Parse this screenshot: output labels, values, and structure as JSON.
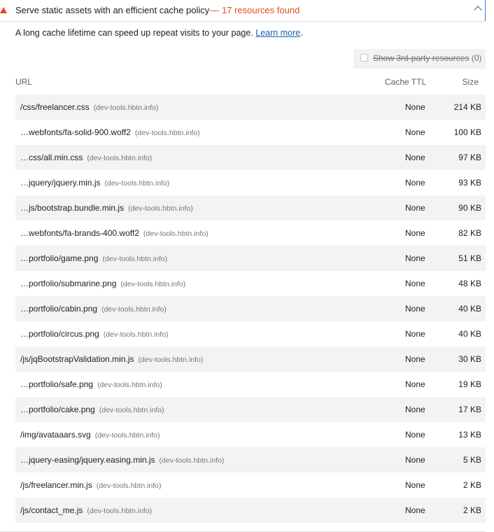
{
  "audit": {
    "title": "Serve static assets with an efficient cache policy",
    "dash": "—",
    "count_text": "17 resources found",
    "description": "A long cache lifetime can speed up repeat visits to your page.",
    "learn_more": "Learn more",
    "trailing_period": ".",
    "icon": "warning-triangle",
    "warning_color": "#e8491d"
  },
  "filter": {
    "label": "Show 3rd-party resources",
    "count": "(0)",
    "checked": false
  },
  "table": {
    "headers": {
      "url": "URL",
      "ttl": "Cache TTL",
      "size": "Size"
    },
    "rows": [
      {
        "url": "/css/freelancer.css",
        "host": "(dev-tools.hbtn.info)",
        "ttl": "None",
        "size": "214 KB"
      },
      {
        "url": "…webfonts/fa-solid-900.woff2",
        "host": "(dev-tools.hbtn.info)",
        "ttl": "None",
        "size": "100 KB"
      },
      {
        "url": "…css/all.min.css",
        "host": "(dev-tools.hbtn.info)",
        "ttl": "None",
        "size": "97 KB"
      },
      {
        "url": "…jquery/jquery.min.js",
        "host": "(dev-tools.hbtn.info)",
        "ttl": "None",
        "size": "93 KB"
      },
      {
        "url": "…js/bootstrap.bundle.min.js",
        "host": "(dev-tools.hbtn.info)",
        "ttl": "None",
        "size": "90 KB"
      },
      {
        "url": "…webfonts/fa-brands-400.woff2",
        "host": "(dev-tools.hbtn.info)",
        "ttl": "None",
        "size": "82 KB"
      },
      {
        "url": "…portfolio/game.png",
        "host": "(dev-tools.hbtn.info)",
        "ttl": "None",
        "size": "51 KB"
      },
      {
        "url": "…portfolio/submarine.png",
        "host": "(dev-tools.hbtn.info)",
        "ttl": "None",
        "size": "48 KB"
      },
      {
        "url": "…portfolio/cabin.png",
        "host": "(dev-tools.hbtn.info)",
        "ttl": "None",
        "size": "40 KB"
      },
      {
        "url": "…portfolio/circus.png",
        "host": "(dev-tools.hbtn.info)",
        "ttl": "None",
        "size": "40 KB"
      },
      {
        "url": "/js/jqBootstrapValidation.min.js",
        "host": "(dev-tools.hbtn.info)",
        "ttl": "None",
        "size": "30 KB"
      },
      {
        "url": "…portfolio/safe.png",
        "host": "(dev-tools.hbtn.info)",
        "ttl": "None",
        "size": "19 KB"
      },
      {
        "url": "…portfolio/cake.png",
        "host": "(dev-tools.hbtn.info)",
        "ttl": "None",
        "size": "17 KB"
      },
      {
        "url": "/img/avataaars.svg",
        "host": "(dev-tools.hbtn.info)",
        "ttl": "None",
        "size": "13 KB"
      },
      {
        "url": "…jquery-easing/jquery.easing.min.js",
        "host": "(dev-tools.hbtn.info)",
        "ttl": "None",
        "size": "5 KB"
      },
      {
        "url": "/js/freelancer.min.js",
        "host": "(dev-tools.hbtn.info)",
        "ttl": "None",
        "size": "2 KB"
      },
      {
        "url": "/js/contact_me.js",
        "host": "(dev-tools.hbtn.info)",
        "ttl": "None",
        "size": "2 KB"
      }
    ]
  }
}
